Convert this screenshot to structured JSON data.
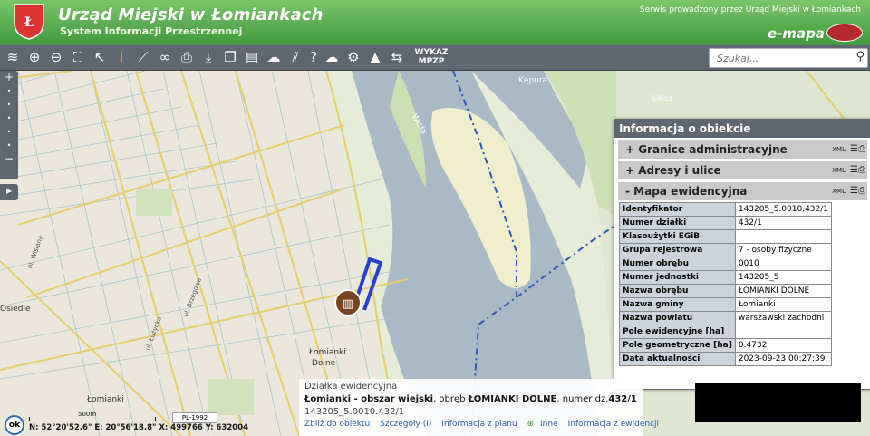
{
  "header": {
    "title": "Urząd Miejski w Łomiankach",
    "subtitle": "System Informacji Przestrzennej",
    "service_text": "Serwis prowadzony przez Urząd Miejski w Łomiankach",
    "brand": "e-mapa"
  },
  "toolbar": {
    "icons": [
      "layers-icon",
      "zoom-in-icon",
      "zoom-out-icon",
      "zoom-extent-icon",
      "select-icon",
      "info-icon",
      "measure-icon",
      "link-icon",
      "print-icon",
      "download-icon",
      "copy-icon",
      "layout-icon",
      "comment-icon",
      "hatch-icon",
      "help-icon",
      "cloud-icon",
      "settings-icon",
      "triangle-icon",
      "share-icon"
    ],
    "wykaz_label": "WYKAZ MPZP"
  },
  "search": {
    "placeholder": "Szukaj..."
  },
  "map_labels": {
    "kepuria": "Kępura",
    "wisla": "Wisła",
    "osiedle": "Osiedle",
    "lomianki_dolne_1": "Łomianki",
    "lomianki_dolne_2": "Dolne",
    "lomianki": "Łomianki",
    "nikisa": "Nikisa",
    "street1": "ul. Wiślana",
    "street2": "ul. Łużycka",
    "street3": "ul. Brzegowa"
  },
  "panel": {
    "title": "Informacja o obiekcie",
    "sections": [
      {
        "label": "Granice administracyjne",
        "sign": "+"
      },
      {
        "label": "Adresy i ulice",
        "sign": "+"
      },
      {
        "label": "Mapa ewidencyjna",
        "sign": "-"
      }
    ],
    "xml": "XML",
    "rows": [
      {
        "k": "Identyfikator",
        "v": "143205_5.0010.432/1"
      },
      {
        "k": "Numer działki",
        "v": "432/1"
      },
      {
        "k": "Klasoużytki EGiB",
        "v": ""
      },
      {
        "k": "Grupa rejestrowa",
        "v": "7 - osoby fizyczne"
      },
      {
        "k": "Numer obrębu",
        "v": "0010"
      },
      {
        "k": "Numer jednostki",
        "v": "143205_5"
      },
      {
        "k": "Nazwa obrębu",
        "v": "ŁOMIANKI DOLNE"
      },
      {
        "k": "Nazwa gminy",
        "v": "Łomianki"
      },
      {
        "k": "Nazwa powiatu",
        "v": "warszawski zachodni"
      },
      {
        "k": "Pole ewidencyjne [ha]",
        "v": ""
      },
      {
        "k": "Pole geometryczne [ha]",
        "v": "0.4732"
      },
      {
        "k": "Data aktualności",
        "v": "2023-09-23 00:27:39"
      }
    ]
  },
  "infobox": {
    "type": "Działka ewidencyjna",
    "line2_bold1": "Łomianki - obszar wiejski",
    "line2_mid": ", obręb ",
    "line2_bold2": "ŁOMIANKI DOLNE",
    "line2_end": ", numer dz.",
    "line2_bold3": "432/1",
    "id": "143205_5.0010.432/1",
    "links": [
      "Zbliż do obiektu",
      "Szczegóły (I)",
      "Informacja z planu",
      "Inne",
      "Informacja z ewidencji"
    ]
  },
  "status": {
    "scale": "500m",
    "crs": "PL-1992",
    "coords": "N: 52°20'52.6\"  E: 20°56'18.8\"   X: 499766     Y: 632004",
    "ok": "ok"
  },
  "colors": {
    "header": "#4fa845",
    "toolbar": "#5e6670",
    "river": "#a9b9c6",
    "parcel": "#2a3fd0"
  }
}
